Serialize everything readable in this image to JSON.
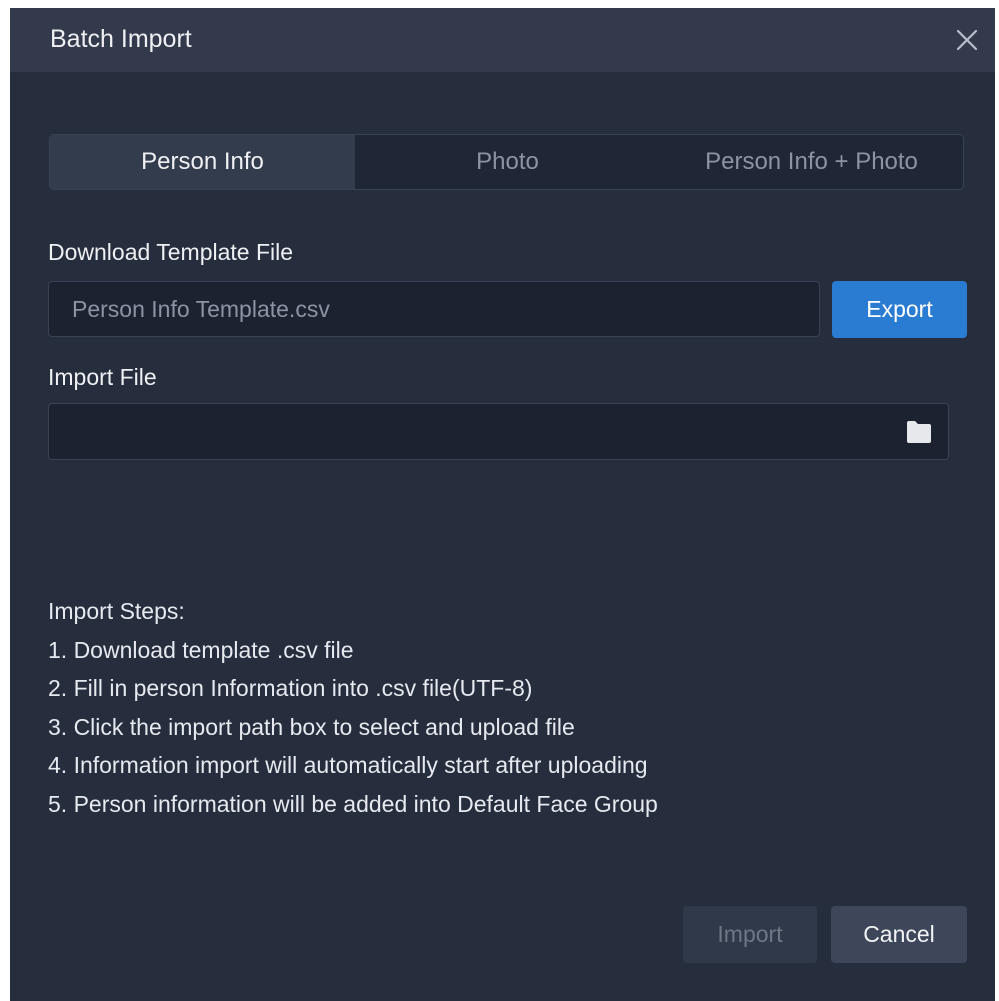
{
  "dialog": {
    "title": "Batch Import",
    "close_icon": "close-icon"
  },
  "tabs": [
    {
      "label": "Person Info",
      "selected": true
    },
    {
      "label": "Photo",
      "selected": false
    },
    {
      "label": "Person Info + Photo",
      "selected": false
    }
  ],
  "download": {
    "label": "Download Template File",
    "value": "Person Info Template.csv",
    "export_label": "Export"
  },
  "import_file": {
    "label": "Import File",
    "value": "",
    "icon": "folder-icon"
  },
  "steps": {
    "heading": "Import Steps:",
    "items": [
      "1. Download template .csv file",
      "2. Fill in person Information into .csv file(UTF-8)",
      "3. Click the import path box to select and upload file",
      "4. Information import will automatically start after uploading",
      "5. Person information will be added into Default Face Group"
    ]
  },
  "footer": {
    "import_label": "Import",
    "cancel_label": "Cancel"
  },
  "colors": {
    "background": "#262e3d",
    "titlebar": "#323a4b",
    "accent": "#2a7bd2"
  }
}
